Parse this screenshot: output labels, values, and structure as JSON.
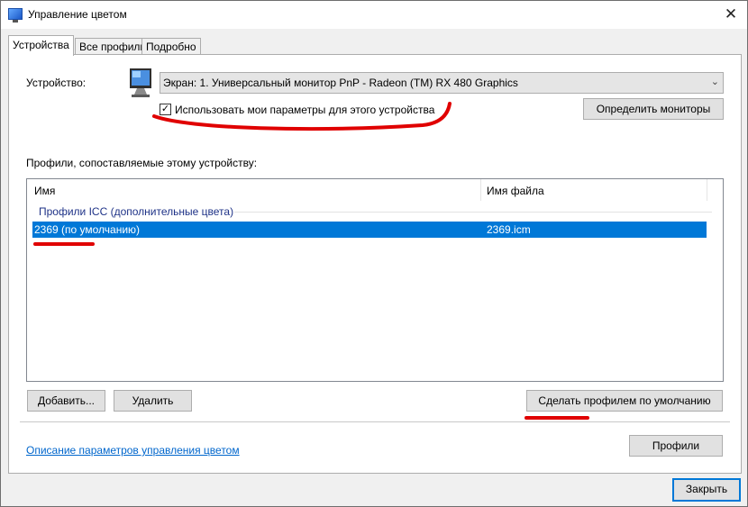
{
  "window": {
    "title": "Управление цветом"
  },
  "tabs": [
    {
      "label": "Устройства",
      "active": true
    },
    {
      "label": "Все профили",
      "active": false
    },
    {
      "label": "Подробно",
      "active": false
    }
  ],
  "device": {
    "label": "Устройство:",
    "selected": "Экран: 1. Универсальный монитор PnP - Radeon (TM) RX 480 Graphics",
    "use_my_settings_label": "Использовать мои параметры для этого устройства",
    "use_my_settings_checked": true,
    "identify_button": "Определить мониторы"
  },
  "profiles": {
    "section_label": "Профили, сопоставляемые этому устройству:",
    "columns": [
      "Имя",
      "Имя файла"
    ],
    "group_label": "Профили ICC (дополнительные цвета)",
    "rows": [
      {
        "name": "2369 (по умолчанию)",
        "file": "2369.icm",
        "selected": true
      }
    ],
    "add_button": "Добавить...",
    "remove_button": "Удалить",
    "set_default_button": "Сделать профилем по умолчанию"
  },
  "footer": {
    "help_link": "Описание параметров управления цветом",
    "profiles_button": "Профили",
    "close_button": "Закрыть"
  },
  "colors": {
    "accent": "#0078d7",
    "annotation": "#e00000"
  }
}
